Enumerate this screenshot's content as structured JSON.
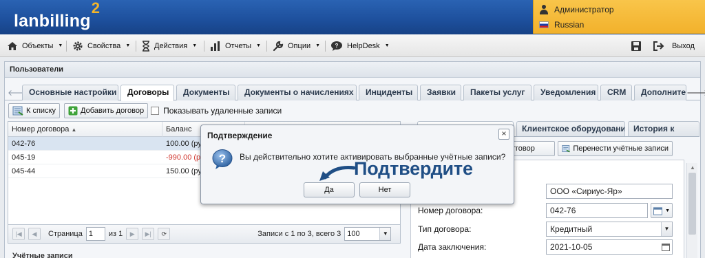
{
  "app": {
    "logo_text": "lanbilling",
    "logo_suffix": "2"
  },
  "user": {
    "name": "Администратор",
    "language": "Russian"
  },
  "menu": [
    {
      "label": "Объекты",
      "icon": "home-icon"
    },
    {
      "label": "Свойства",
      "icon": "gear-icon"
    },
    {
      "label": "Действия",
      "icon": "hourglass-icon"
    },
    {
      "label": "Отчеты",
      "icon": "bar-chart-icon"
    },
    {
      "label": "Опции",
      "icon": "wrench-icon"
    },
    {
      "label": "HelpDesk",
      "icon": "speech-bubble-icon"
    }
  ],
  "exit_label": "Выход",
  "panel": {
    "title": "Пользователи"
  },
  "tabs": [
    {
      "label": "Основные настройки"
    },
    {
      "label": "Договоры",
      "active": true
    },
    {
      "label": "Документы"
    },
    {
      "label": "Документы о начислениях"
    },
    {
      "label": "Инциденты"
    },
    {
      "label": "Заявки"
    },
    {
      "label": "Пакеты услуг"
    },
    {
      "label": "Уведомления"
    },
    {
      "label": "CRM"
    },
    {
      "label": "Дополнител"
    }
  ],
  "toolbar": {
    "to_list": "К списку",
    "add_contract": "Добавить договор",
    "show_deleted": "Показывать удаленные записи"
  },
  "grid": {
    "columns": [
      "Номер договора",
      "Баланс"
    ],
    "rows": [
      {
        "number": "042-76",
        "balance": "100.00 (ру",
        "selected": true,
        "negative": false
      },
      {
        "number": "045-19",
        "balance": "-990.00 (р",
        "selected": false,
        "negative": true
      },
      {
        "number": "045-44",
        "balance": "150.00 (ру",
        "selected": false,
        "negative": false
      }
    ]
  },
  "pager": {
    "page_label": "Страница",
    "page_value": "1",
    "of_label": "из 1",
    "records_label": "Записи с 1 по 3, всего 3",
    "page_size": "100"
  },
  "bottom_title": "Учётные записи",
  "right": {
    "tabs": [
      "Клиентское оборудование",
      "История к"
    ],
    "btn_contract_partial": "тговор",
    "btn_transfer": "Перенести учётные записи",
    "form": {
      "company_value": "ООО «Сириус-Яр»",
      "contract_label": "Номер договора:",
      "contract_value": "042-76",
      "type_label": "Тип договора:",
      "type_value": "Кредитный",
      "date_label": "Дата заключения:",
      "date_value": "2021-10-05"
    }
  },
  "modal": {
    "title": "Подтверждение",
    "message": "Вы действительно хотите активировать выбранные учётные записи?",
    "hint": "Подтвердите",
    "yes": "Да",
    "no": "Нет"
  },
  "colors": {
    "header_blue": "#1d4f9c",
    "user_panel_yellow": "#f2b12b",
    "negative_red": "#d0342c",
    "hint_blue": "#1f4e85",
    "selected_row": "#d9e4f1"
  }
}
